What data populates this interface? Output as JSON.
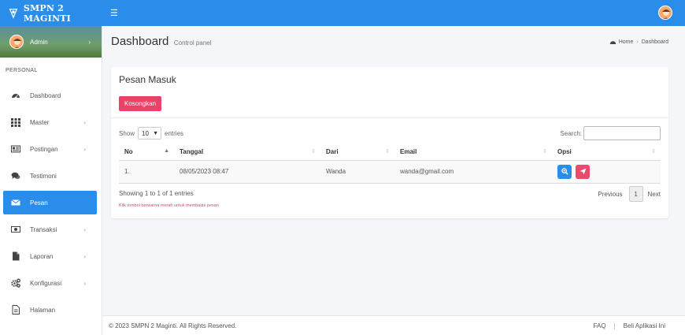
{
  "app": {
    "brand": "SMPN 2 MAGINTI"
  },
  "sidebar": {
    "user": {
      "name": "Admin"
    },
    "section": "PERSONAL",
    "items": [
      {
        "label": "Dashboard",
        "icon": "dashboard-icon"
      },
      {
        "label": "Master",
        "icon": "grid-icon"
      },
      {
        "label": "Postingan",
        "icon": "newspaper-icon"
      },
      {
        "label": "Testimoni",
        "icon": "comments-icon"
      },
      {
        "label": "Pesan",
        "icon": "envelope-icon"
      },
      {
        "label": "Transaksi",
        "icon": "money-icon"
      },
      {
        "label": "Laporan",
        "icon": "file-icon"
      },
      {
        "label": "Konfigurasi",
        "icon": "cogs-icon"
      },
      {
        "label": "Halaman",
        "icon": "page-icon"
      }
    ]
  },
  "header": {
    "title": "Dashboard",
    "subtitle": "Control panel",
    "breadcrumb": [
      "Home",
      "Dashboard"
    ]
  },
  "box": {
    "title": "Pesan Masuk",
    "clear_button": "Kosongkan",
    "show_label": "Show",
    "entries_value": "10",
    "entries_label": "entries",
    "search_label": "Search:",
    "columns": [
      "No",
      "Tanggal",
      "Dari",
      "Email",
      "Opsi"
    ],
    "rows": [
      {
        "no": "1.",
        "tanggal": "08/05/2023 08:47",
        "dari": "Wanda",
        "email": "wanda@gmail.com"
      }
    ],
    "info": "Showing 1 to 1 of 1 entries",
    "note": "Klik tombol  berwarna merah untuk membalas pesan",
    "pager": {
      "previous": "Previous",
      "current": "1",
      "next": "Next"
    }
  },
  "footer": {
    "copyright": "© 2023 SMPN 2 Maginti. All Rights Reserved.",
    "links": [
      "FAQ",
      "Beli Aplikasi Ini"
    ]
  },
  "colors": {
    "primary": "#2a8de9",
    "danger": "#e84266",
    "active_nav": "#2a8de9"
  }
}
